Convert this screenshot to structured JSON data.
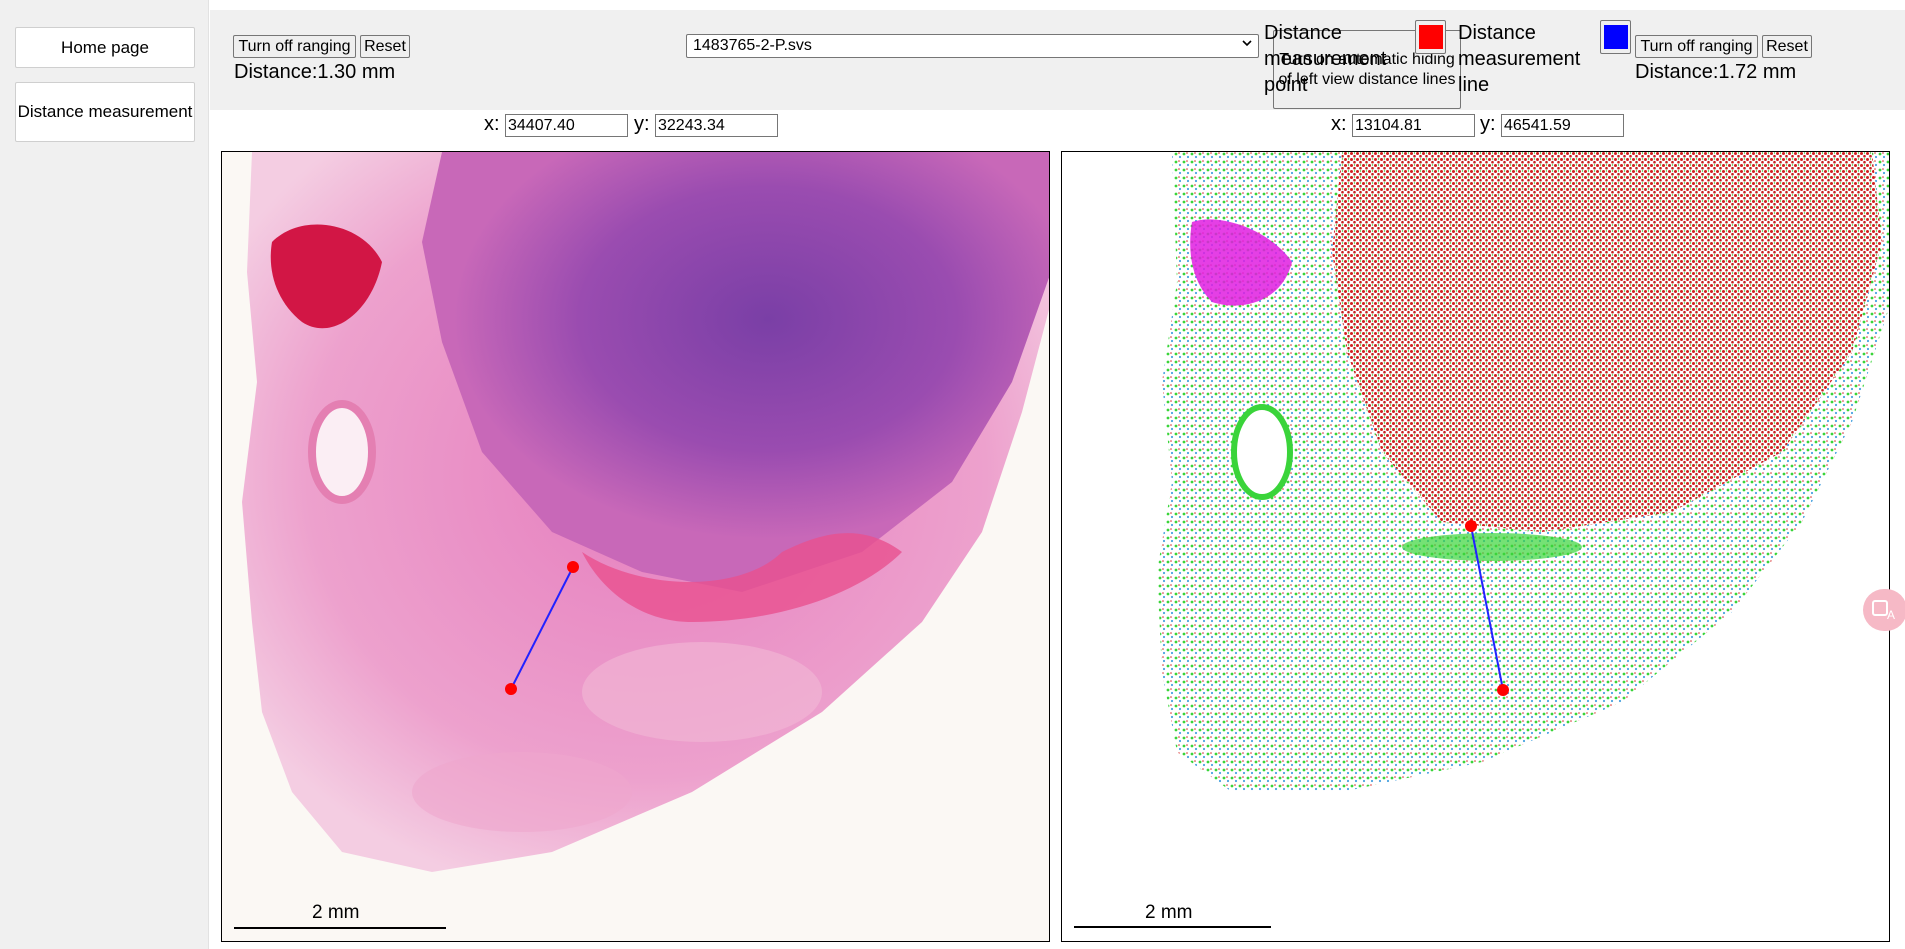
{
  "sidebar": {
    "home_label": "Home page",
    "distance_label": "Distance measurement"
  },
  "left_panel": {
    "toggle_ranging_label": "Turn off ranging",
    "reset_label": "Reset",
    "distance_text": "Distance:1.30 mm",
    "coord_x_label": "x:",
    "coord_x_value": "34407.40",
    "coord_y_label": "y:",
    "coord_y_value": "32243.34",
    "scale_label": "2 mm"
  },
  "right_panel": {
    "toggle_ranging_label": "Turn off ranging",
    "reset_label": "Reset",
    "distance_text": "Distance:1.72 mm",
    "coord_x_label": "x:",
    "coord_x_value": "13104.81",
    "coord_y_label": "y:",
    "coord_y_value": "46541.59",
    "scale_label": "2 mm"
  },
  "file_select": {
    "selected": "1483765-2-P.svs"
  },
  "auto_hide_label": "Turn on automatic hiding of left view distance lines",
  "legend": {
    "point_label": "Distance measurement point",
    "point_color": "#ff0000",
    "line_label": "Distance measurement line",
    "line_color": "#0000ff"
  },
  "icons": {
    "dropdown": "chevron-down-icon",
    "fab": "translate-icon"
  }
}
